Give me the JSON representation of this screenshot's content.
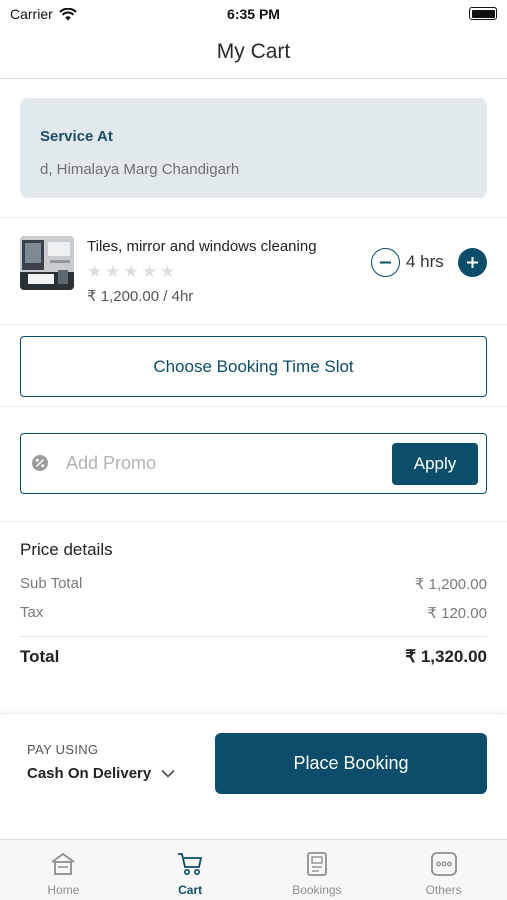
{
  "status_bar": {
    "carrier": "Carrier",
    "time": "6:35 PM"
  },
  "header": {
    "title": "My Cart"
  },
  "service": {
    "title": "Service At",
    "address": "d, Himalaya Marg Chandigarh"
  },
  "cart_item": {
    "name": "Tiles, mirror and windows cleaning",
    "rating": 0,
    "stars": "★★★★★",
    "price": "₹ 1,200.00  / 4hr",
    "quantity": "4 hrs"
  },
  "booking_slot": {
    "label": "Choose Booking Time Slot"
  },
  "promo": {
    "placeholder": "Add Promo",
    "apply_label": "Apply"
  },
  "price_details": {
    "heading": "Price details",
    "rows": [
      {
        "label": "Sub Total",
        "value": "₹ 1,200.00"
      },
      {
        "label": "Tax",
        "value": "₹ 120.00"
      }
    ],
    "total": {
      "label": "Total",
      "value": "₹ 1,320.00"
    }
  },
  "checkout": {
    "pay_using": "PAY USING",
    "method": "Cash On Delivery",
    "place_booking": "Place Booking"
  },
  "tabs": [
    {
      "label": "Home",
      "icon": "home-icon",
      "active": false
    },
    {
      "label": "Cart",
      "icon": "cart-icon",
      "active": true
    },
    {
      "label": "Bookings",
      "icon": "bookings-icon",
      "active": false
    },
    {
      "label": "Others",
      "icon": "more-icon",
      "active": false
    }
  ],
  "colors": {
    "primary": "#0b4d6a",
    "service_card_bg": "#e1e9ed",
    "inactive_tab": "#8e8e8e"
  }
}
